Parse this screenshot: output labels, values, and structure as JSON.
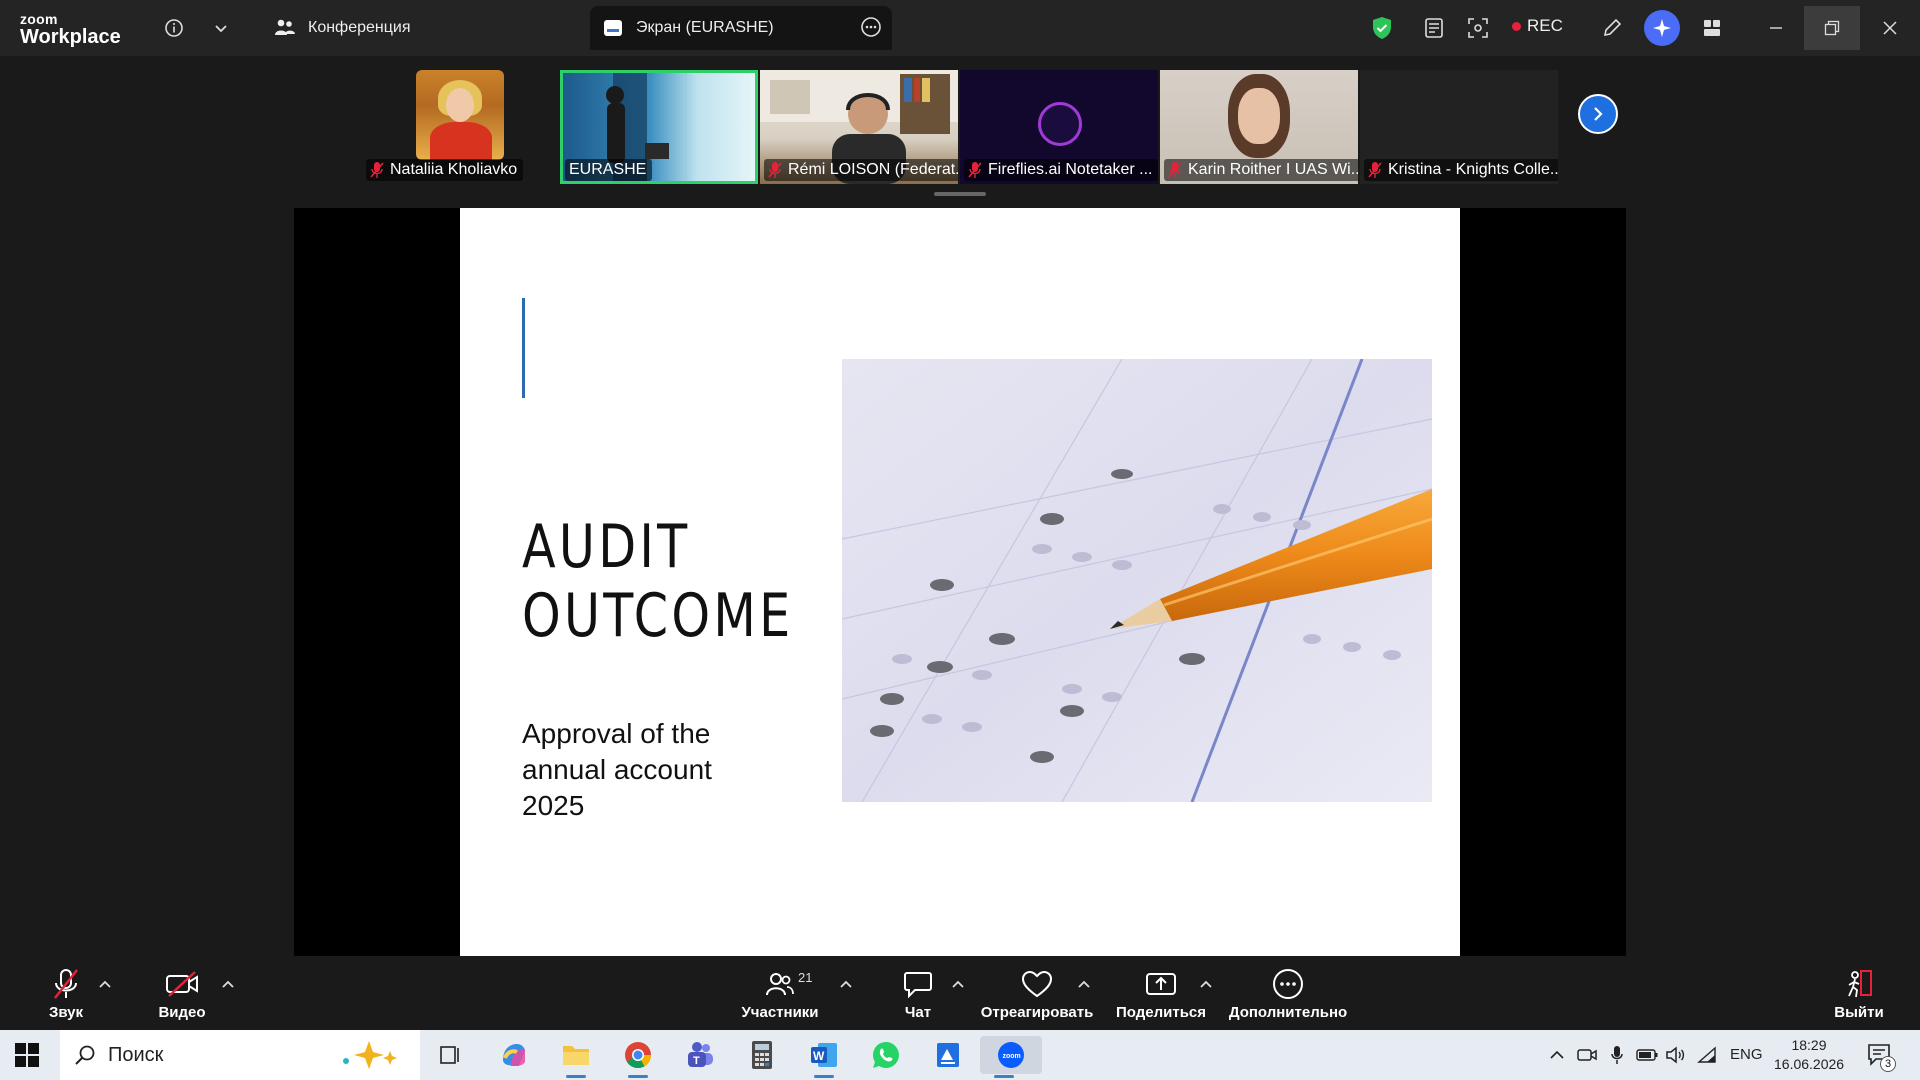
{
  "app": {
    "logo_small": "zoom",
    "logo_large": "Workplace"
  },
  "tabs": [
    {
      "label": "Конференция",
      "icon": "people-icon"
    },
    {
      "label": "Экран (EURASHE)",
      "icon": "screen-share-icon"
    }
  ],
  "top_right": {
    "rec_label": "REC",
    "rec_color": "#e8213a",
    "shield_color": "#2ec45a",
    "ai_color": "#4a6cf7"
  },
  "participants": [
    {
      "name": "Nataliia Kholiavko",
      "muted": true
    },
    {
      "name": "EURASHE",
      "muted": false,
      "active_speaker": true
    },
    {
      "name": "Rémi LOISON (Federat...",
      "muted": true
    },
    {
      "name": "Fireflies.ai Notetaker ...",
      "muted": true
    },
    {
      "name": "Karin Roither I UAS Wi...",
      "muted": true
    },
    {
      "name": "Kristina - Knights Colle...",
      "muted": true
    }
  ],
  "slide": {
    "title_lines": [
      "AUDIT",
      "OUTCOME"
    ],
    "subtitle_lines": [
      "Approval of the",
      "annual account",
      "2025"
    ],
    "accent_color": "#2b6cb0",
    "image": "answer-sheet-with-pencil"
  },
  "toolbar": {
    "audio_label": "Звук",
    "video_label": "Видео",
    "participants_label": "Участники",
    "participants_count": "21",
    "chat_label": "Чат",
    "react_label": "Отреагировать",
    "share_label": "Поделиться",
    "more_label": "Дополнительно",
    "leave_label": "Выйти",
    "leave_color": "#e8213a"
  },
  "taskbar": {
    "search_placeholder": "Поиск",
    "apps": [
      "task-view",
      "copilot",
      "file-explorer",
      "chrome",
      "teams",
      "calculator",
      "word",
      "whatsapp",
      "document-app",
      "zoom"
    ],
    "language": "ENG",
    "time": "18:29",
    "date": "16.06.2026",
    "notifications": "3"
  }
}
